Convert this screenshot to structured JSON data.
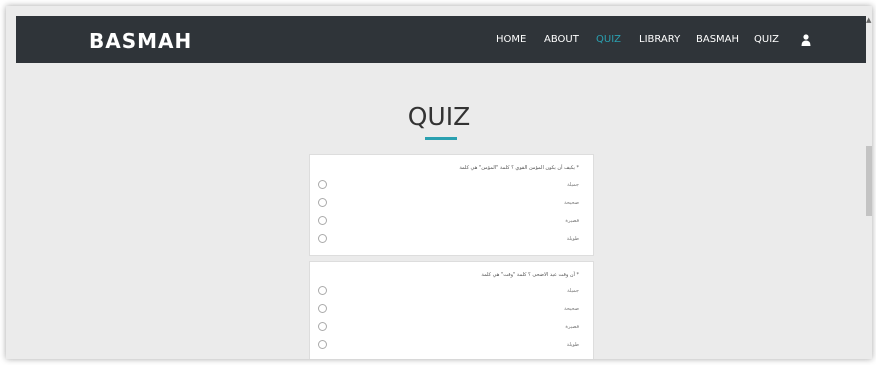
{
  "brand": "BASMAH",
  "nav": [
    {
      "label": "HOME",
      "active": false
    },
    {
      "label": "ABOUT",
      "active": false
    },
    {
      "label": "QUIZ",
      "active": true
    },
    {
      "label": "LIBRARY",
      "active": false
    },
    {
      "label": "BASMAH",
      "active": false
    },
    {
      "label": "QUIZ",
      "active": false
    }
  ],
  "user_icon": "user-icon",
  "accent_color": "#2aa0b0",
  "page_title": "QUIZ",
  "questions": [
    {
      "text": "* يكيف أن يكون المؤمن القوي ؟ كلمة \"المؤمن\" هي كلمة",
      "options": [
        "جميلة",
        "صحيحة",
        "قصيرة",
        "طويلة"
      ]
    },
    {
      "text": "* أن وقت عيد الاضحى ؟ كلمة \"وقت\" هي كلمة",
      "options": [
        "جميلة",
        "صحيحة",
        "قصيرة",
        "طويلة"
      ]
    }
  ]
}
